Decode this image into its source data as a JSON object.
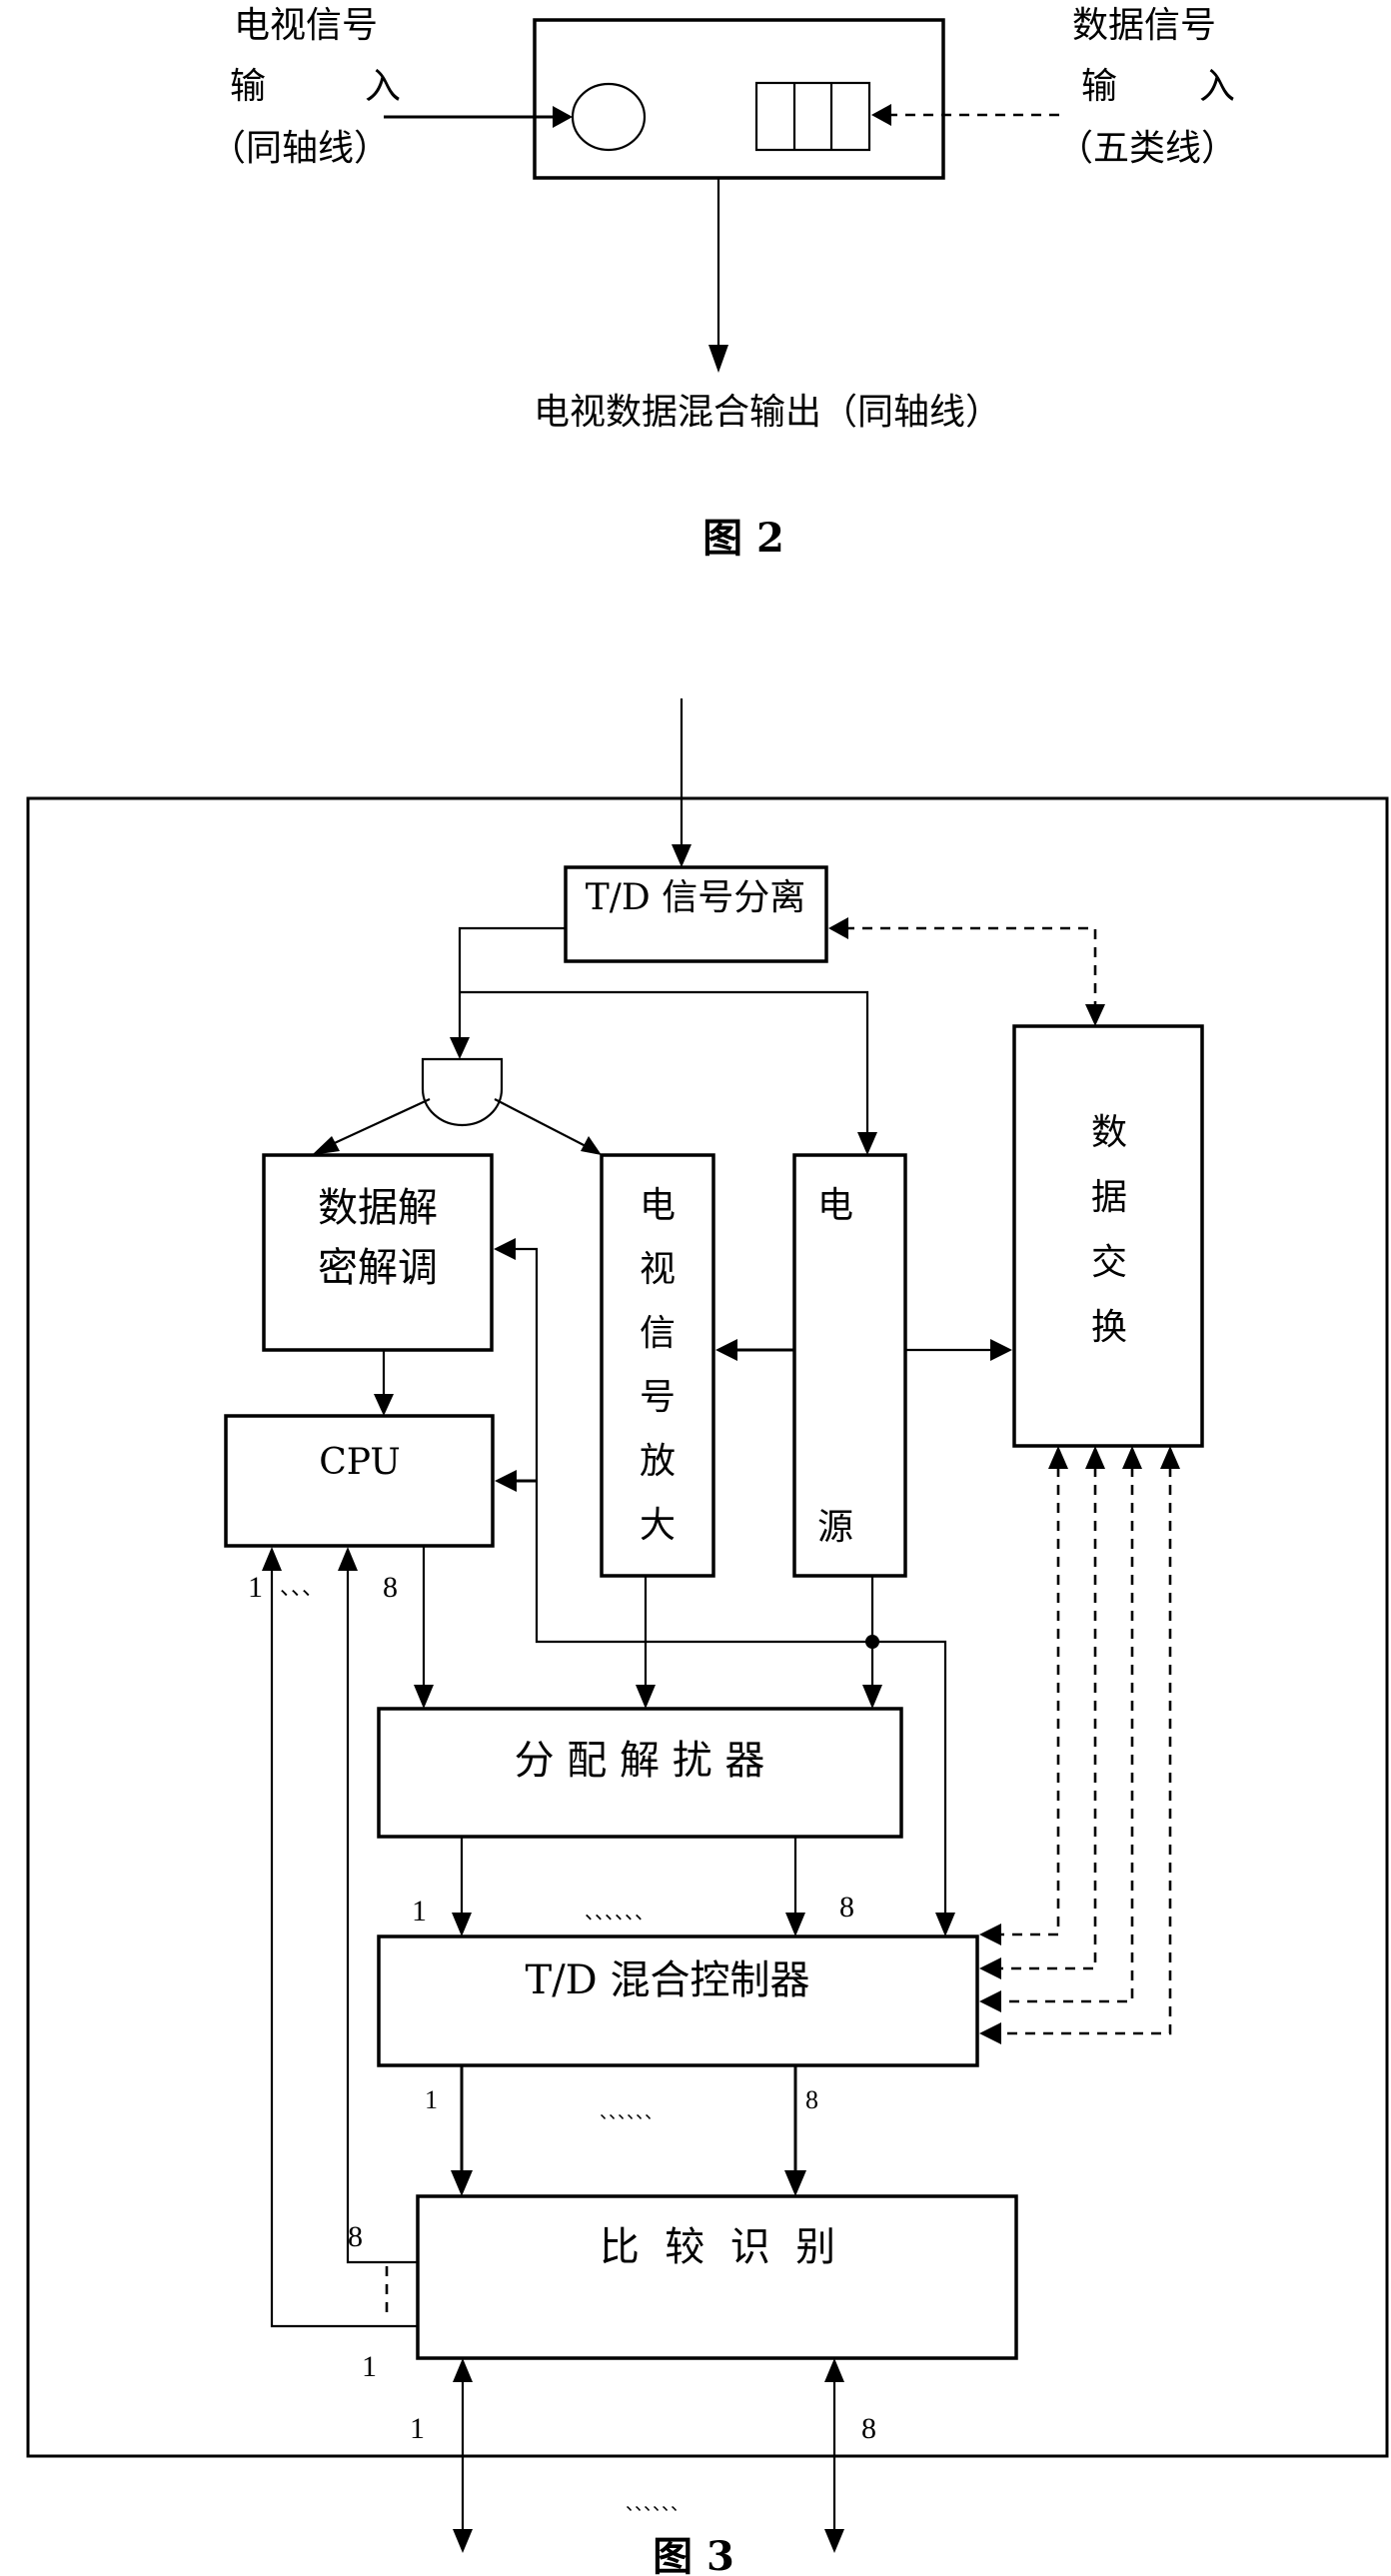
{
  "figure2": {
    "left_input": {
      "line1": "电视信号",
      "line2_a": "输",
      "line2_b": "入",
      "line3": "（同轴线）"
    },
    "right_input": {
      "line1": "数据信号",
      "line2_a": "输",
      "line2_b": "入",
      "line3": "（五类线）"
    },
    "output_label": "电视数据混合输出（同轴线）",
    "caption": "图 2"
  },
  "figure3": {
    "blocks": {
      "td_separation": "T/D 信号分离",
      "data_decrypt_line1": "数据解",
      "data_decrypt_line2": "密解调",
      "tv_amp": [
        "电",
        "视",
        "信",
        "号",
        "放",
        "大"
      ],
      "power": [
        "电",
        "源"
      ],
      "data_exchange": [
        "数",
        "据",
        "交",
        "换"
      ],
      "cpu": "CPU",
      "distributor": "分 配 解 扰 器",
      "td_mixer": "T/D 混合控制器",
      "compare": "比  较  识  别"
    },
    "port_labels": {
      "cpu_in_first": "1",
      "cpu_in_dots": "、、、",
      "cpu_out": "8",
      "dist_out_first": "1",
      "dist_out_dots": "、、、、、、",
      "dist_out_last": "8",
      "mixer_out_first": "1",
      "mixer_out_dots": "、、、、、、",
      "mixer_out_last": "8",
      "compare_fb_8": "8",
      "compare_fb_1": "1",
      "bottom_first": "1",
      "bottom_last": "8",
      "bottom_dots": "、、、、、、"
    },
    "caption": "图 3"
  }
}
